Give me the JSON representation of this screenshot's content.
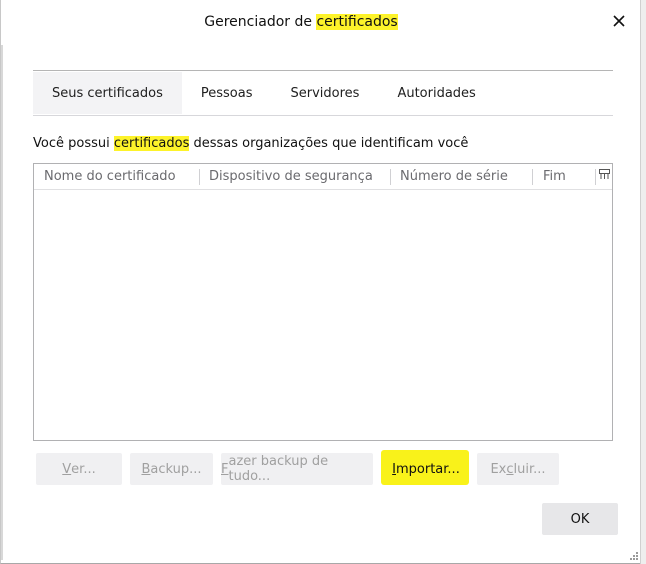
{
  "dialog": {
    "title_prefix": "Gerenciador de ",
    "title_highlight": "certificados",
    "close_glyph": "✕"
  },
  "tabs": [
    {
      "label": "Seus certificados",
      "selected": true
    },
    {
      "label": "Pessoas",
      "selected": false
    },
    {
      "label": "Servidores",
      "selected": false
    },
    {
      "label": "Autoridades",
      "selected": false
    }
  ],
  "description": {
    "prefix": "Você possui ",
    "highlight": "certificados",
    "suffix": " dessas organizações que identificam você"
  },
  "table": {
    "columns": [
      "Nome do certificado",
      "Dispositivo de segurança",
      "Número de série",
      "Fim"
    ],
    "rows": []
  },
  "buttons": {
    "view": {
      "access_key": "V",
      "rest": "er...",
      "enabled": false
    },
    "backup": {
      "access_key": "B",
      "rest": "ackup...",
      "enabled": false
    },
    "backup_all": {
      "access_key": "F",
      "rest": "azer backup de tudo...",
      "enabled": false
    },
    "import": {
      "access_key": "I",
      "rest": "mportar...",
      "enabled": true
    },
    "delete": {
      "before": "Ex",
      "access_key": "c",
      "rest": "luir...",
      "enabled": false
    },
    "ok": "OK"
  },
  "icons": {
    "close": "close-icon",
    "column_picker": "column-picker-icon",
    "resize": "resize-grip-icon"
  },
  "colors": {
    "highlight": "#fdf32a",
    "selected_tab": "#f3f3f5",
    "button": "#ececee"
  }
}
